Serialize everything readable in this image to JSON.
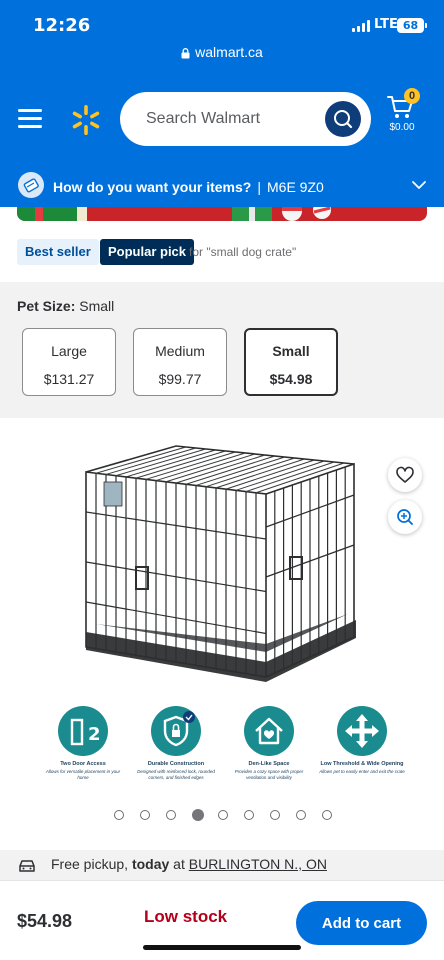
{
  "status_bar": {
    "time": "12:26",
    "network": "LTE",
    "battery": "68"
  },
  "browser": {
    "url": "walmart.ca"
  },
  "header": {
    "search_placeholder": "Search Walmart",
    "cart_count": "0",
    "cart_total": "$0.00",
    "delivery_prompt": "How do you want your items?",
    "delivery_separator": "|",
    "postal_code": "M6E 9Z0",
    "icons": [
      "hamburger-menu-icon",
      "walmart-spark-icon",
      "search-icon",
      "cart-icon",
      "chevron-down-icon"
    ]
  },
  "badges": {
    "best_seller": "Best seller",
    "popular_pick": "Popular pick",
    "popular_context": "for \"small dog crate\""
  },
  "variants": {
    "label": "Pet Size:",
    "selected_value": "Small",
    "options": [
      {
        "name": "Large",
        "price": "$131.27"
      },
      {
        "name": "Medium",
        "price": "$99.77"
      },
      {
        "name": "Small",
        "price": "$54.98"
      }
    ]
  },
  "gallery": {
    "features": [
      {
        "title": "Two Door Access",
        "desc": "Allows for versatile placement in your home"
      },
      {
        "title": "Durable Construction",
        "desc": "Designed with reinforced lock, rounded corners, and finished edges"
      },
      {
        "title": "Den-Like Space",
        "desc": "Provides a cozy space with proper ventilation and visibility"
      },
      {
        "title": "Low Threshold & Wide Opening",
        "desc": "Allows pet to easily enter and exit the crate"
      }
    ],
    "dot_count": 9,
    "active_dot": 4
  },
  "pickup": {
    "prefix": "Free pickup,",
    "when": "today",
    "at": "at",
    "store": "BURLINGTON N., ON"
  },
  "bottom_bar": {
    "price": "$54.98",
    "stock_status": "Low stock",
    "cta": "Add to cart"
  },
  "colors": {
    "brand_blue": "#0071dc",
    "spark_yellow": "#ffc220",
    "low_stock_red": "#b3001b",
    "feature_teal": "#1a8c8f"
  }
}
